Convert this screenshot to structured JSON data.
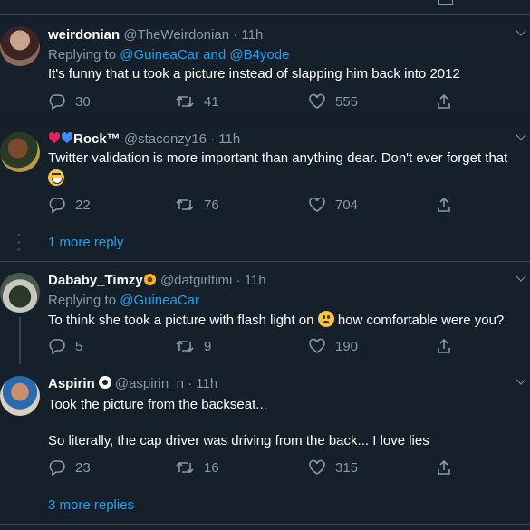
{
  "colors": {
    "background": "#15202b",
    "accent": "#1da1f2",
    "muted": "#8899a6",
    "divider": "#38444d"
  },
  "tweets": [
    {
      "name": "weirdonian",
      "handle": "@TheWeirdonian",
      "time": "· 11h",
      "replying_prefix": "Replying to",
      "replying_to": "@GuineaCar and @B4yode",
      "text": "It's funny that u took a picture instead of slapping him back into 2012",
      "replies": "30",
      "retweets": "41",
      "likes": "555"
    },
    {
      "name": "Rock™",
      "handle": "@staconzy16",
      "time": "· 11h",
      "text": "Twitter validation is more important than anything dear. Don't ever forget that",
      "replies": "22",
      "retweets": "76",
      "likes": "704",
      "more_replies": "1 more reply"
    },
    {
      "name": "Dababy_Timzy",
      "handle": "@datgirltimi",
      "time": "· 11h",
      "replying_prefix": "Replying to",
      "replying_to": "@GuineaCar",
      "text_a": "To think she took a picture with flash light on",
      "text_b": "how comfortable were you?",
      "replies": "5",
      "retweets": "9",
      "likes": "190"
    },
    {
      "name": "Aspirin",
      "handle": "@aspirin_n",
      "time": "· 11h",
      "text_line1": "Took the picture from the backseat...",
      "text_line2": "So literally, the cap driver was driving from the back... I love lies",
      "replies": "23",
      "retweets": "16",
      "likes": "315",
      "more_replies": "3 more replies"
    }
  ],
  "icons": [
    "reply-icon",
    "retweet-icon",
    "like-icon",
    "share-icon",
    "chevron-down-icon"
  ]
}
